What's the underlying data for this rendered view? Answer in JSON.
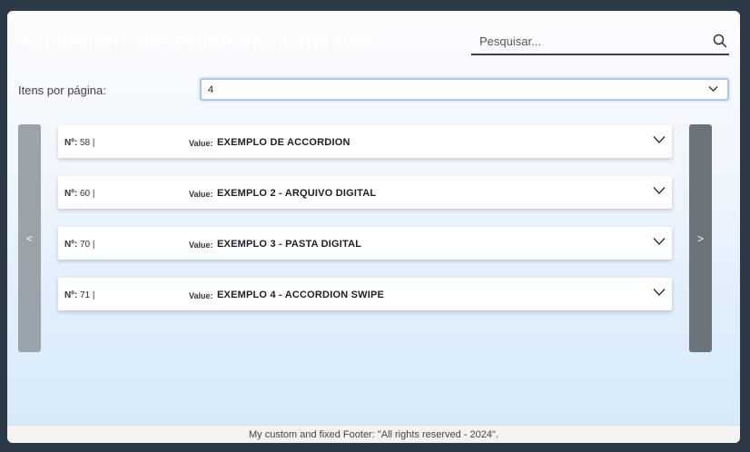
{
  "header": {
    "title": "Accordion com swipe em Nodeflow",
    "search_placeholder": "Pesquisar..."
  },
  "pagination": {
    "per_page_label": "Itens por página:",
    "per_page_value": "4",
    "prev_label": "<",
    "next_label": ">"
  },
  "items": [
    {
      "no_label": "Nº:",
      "no": "58 |",
      "value_label": "Value:",
      "value": "EXEMPLO DE ACCORDION"
    },
    {
      "no_label": "Nº:",
      "no": "60 |",
      "value_label": "Value:",
      "value": "EXEMPLO 2 - ARQUIVO DIGITAL"
    },
    {
      "no_label": "Nº:",
      "no": "70 |",
      "value_label": "Value:",
      "value": "EXEMPLO 3 - PASTA DIGITAL"
    },
    {
      "no_label": "Nº:",
      "no": "71 |",
      "value_label": "Value:",
      "value": "EXEMPLO 4 - ACCORDION SWIPE"
    }
  ],
  "footer": {
    "text": "My custom and fixed Footer: \"All rights reserved - 2024\"."
  },
  "colors": {
    "background": "#2c3946",
    "nav_prev": "#9aa3aa",
    "nav_next": "#6b737b",
    "select_border": "#a9c8f0"
  },
  "icons": {
    "search": "search-icon",
    "select_caret": "chevron-down-icon",
    "item_toggle": "chevron-down-icon"
  }
}
